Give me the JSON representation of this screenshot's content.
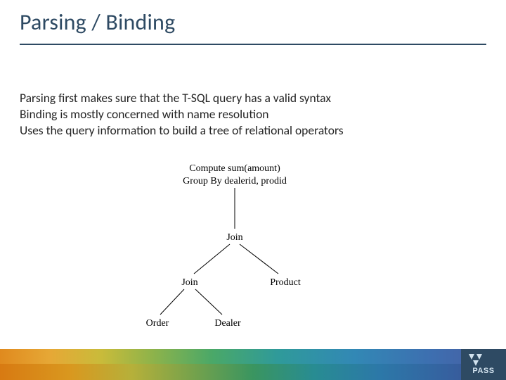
{
  "title": "Parsing / Binding",
  "body": {
    "line1": "Parsing first makes sure that the T-SQL query has a valid syntax",
    "line2": "Binding is mostly concerned with name resolution",
    "line3": "Uses the query information to build a tree of relational operators"
  },
  "diagram": {
    "root1": "Compute sum(amount)",
    "root2": "Group By dealerid, prodid",
    "join_top": "Join",
    "join_left": "Join",
    "product": "Product",
    "order": "Order",
    "dealer": "Dealer"
  },
  "logo": {
    "text": "PASS"
  }
}
